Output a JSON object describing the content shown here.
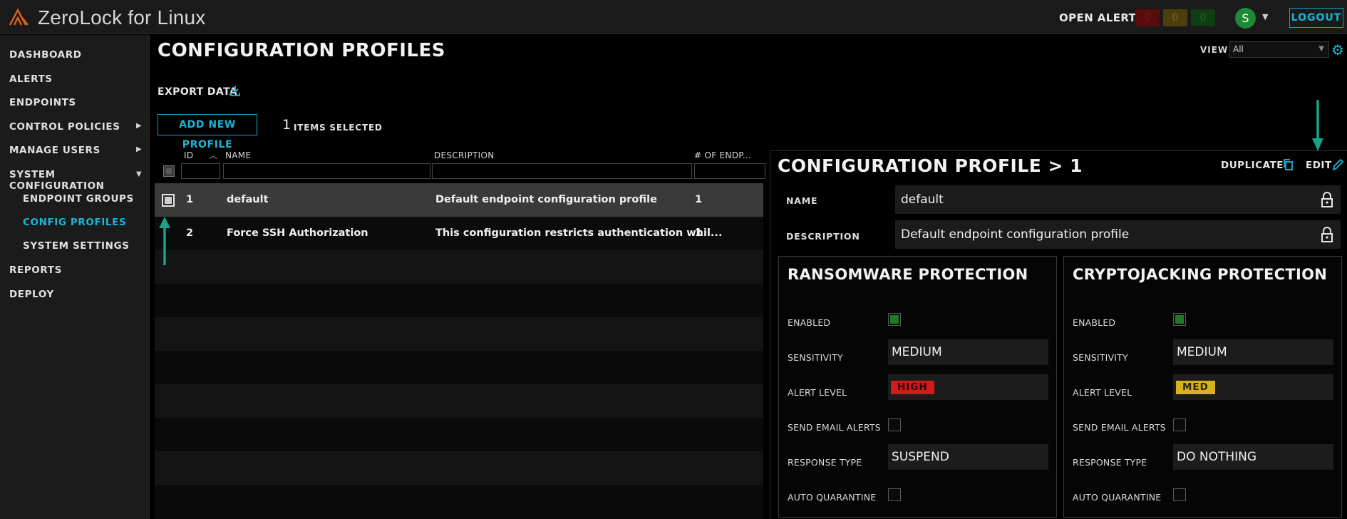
{
  "app": {
    "title": "ZeroLock for Linux"
  },
  "header": {
    "open_alerts_label": "OPEN ALERTS",
    "alerts": {
      "red": "0",
      "yellow": "0",
      "green": "0"
    },
    "user_initial": "S",
    "logout_label": "LOGOUT",
    "colors": {
      "accent": "#19b6d8",
      "logo": "#e2601f",
      "avatar": "#1f8a35"
    }
  },
  "sidebar": {
    "items": [
      {
        "label": "DASHBOARD"
      },
      {
        "label": "ALERTS"
      },
      {
        "label": "ENDPOINTS"
      },
      {
        "label": "CONTROL POLICIES",
        "arrow": "right"
      },
      {
        "label": "MANAGE USERS",
        "arrow": "right"
      },
      {
        "label": "SYSTEM CONFIGURATION",
        "arrow": "down"
      },
      {
        "label": "ENDPOINT GROUPS"
      },
      {
        "label": "CONFIG PROFILES",
        "active": true
      },
      {
        "label": "SYSTEM SETTINGS"
      },
      {
        "label": "REPORTS"
      },
      {
        "label": "DEPLOY"
      }
    ]
  },
  "main": {
    "title": "CONFIGURATION PROFILES",
    "view_label": "VIEW",
    "view_value": "All",
    "export_label": "EXPORT DATA",
    "add_profile_label": "ADD NEW PROFILE",
    "selected_count": "1",
    "selected_label": "ITEMS SELECTED"
  },
  "table": {
    "columns": [
      "ID",
      "NAME",
      "DESCRIPTION",
      "# OF ENDP..."
    ],
    "rows": [
      {
        "id": "1",
        "name": "default",
        "description": "Default endpoint configuration profile",
        "endpoints": "1",
        "selected": true
      },
      {
        "id": "2",
        "name": "Force SSH Authorization",
        "description": "This configuration restricts authentication whil...",
        "endpoints": "1",
        "selected": false
      }
    ]
  },
  "detail": {
    "title": "CONFIGURATION PROFILE > 1",
    "duplicate_label": "DUPLICATE",
    "edit_label": "EDIT",
    "name_label": "NAME",
    "name_value": "default",
    "description_label": "DESCRIPTION",
    "description_value": "Default endpoint configuration profile",
    "field_labels": {
      "enabled": "ENABLED",
      "sensitivity": "SENSITIVITY",
      "alert_level": "ALERT LEVEL",
      "send_email": "SEND EMAIL ALERTS",
      "response_type": "RESPONSE TYPE",
      "auto_quarantine": "AUTO QUARANTINE"
    },
    "ransomware": {
      "title": "RANSOMWARE PROTECTION",
      "enabled": true,
      "sensitivity": "MEDIUM",
      "alert_level": "HIGH",
      "send_email": false,
      "response_type": "SUSPEND",
      "auto_quarantine": false
    },
    "cryptojacking": {
      "title": "CRYPTOJACKING PROTECTION",
      "enabled": true,
      "sensitivity": "MEDIUM",
      "alert_level": "MED",
      "send_email": false,
      "response_type": "DO NOTHING",
      "auto_quarantine": false
    }
  }
}
